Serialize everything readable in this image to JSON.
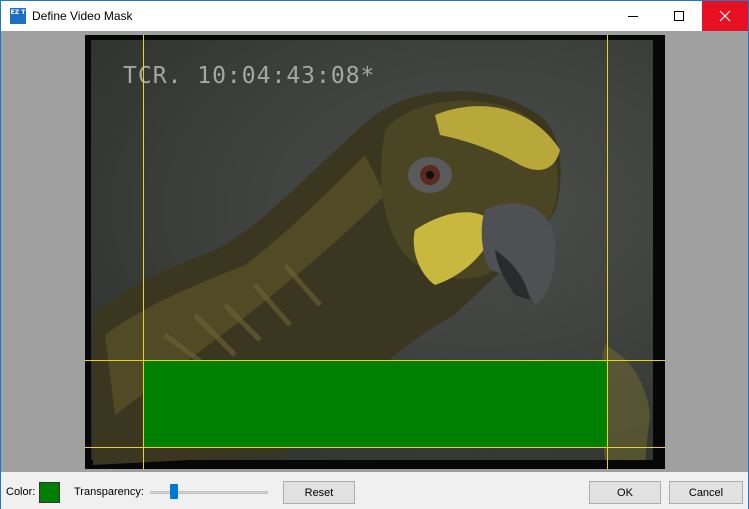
{
  "window": {
    "title": "Define Video Mask",
    "icon": "ez-app-icon",
    "icon_text": "EZ T"
  },
  "preview": {
    "timecode_overlay": "TCR. 10:04:43:08*",
    "mask_color": "#007f00",
    "guide_color": "#e8d31a"
  },
  "toolbar": {
    "color_label": "Color:",
    "swatch_color": "#007f00",
    "transparency_label": "Transparency:",
    "transparency_level": 0.2,
    "reset_label": "Reset",
    "ok_label": "OK",
    "cancel_label": "Cancel"
  }
}
